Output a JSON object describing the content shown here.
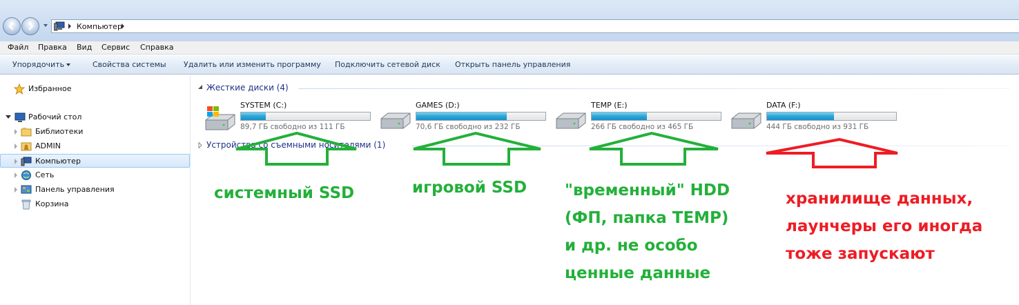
{
  "window": {
    "breadcrumb": "Компьютер"
  },
  "menu": [
    "Файл",
    "Правка",
    "Вид",
    "Сервис",
    "Справка"
  ],
  "toolbar": {
    "organize": "Упорядочить",
    "system_properties": "Свойства системы",
    "uninstall": "Удалить или изменить программу",
    "map_drive": "Подключить сетевой диск",
    "control_panel": "Открыть панель управления"
  },
  "nav": {
    "favorites": "Избранное",
    "desktop": "Рабочий стол",
    "libraries": "Библиотеки",
    "admin": "ADMIN",
    "computer": "Компьютер",
    "network": "Сеть",
    "control_panel": "Панель управления",
    "recycle": "Корзина"
  },
  "groups": {
    "hard_disks": "Жесткие диски (4)",
    "removable": "Устройства со съемными носителями (1)"
  },
  "drives": [
    {
      "name": "SYSTEM (C:)",
      "free": "89,7 ГБ свободно из 111 ГБ",
      "used_fraction": 0.19,
      "icon": "system-drive-icon"
    },
    {
      "name": "GAMES (D:)",
      "free": "70,6 ГБ свободно из 232 ГБ",
      "used_fraction": 0.7,
      "icon": "hard-drive-icon"
    },
    {
      "name": "TEMP (E:)",
      "free": "266 ГБ свободно из 465 ГБ",
      "used_fraction": 0.43,
      "icon": "hard-drive-icon"
    },
    {
      "name": "DATA (F:)",
      "free": "444 ГБ свободно из 931 ГБ",
      "used_fraction": 0.52,
      "icon": "hard-drive-icon"
    }
  ],
  "annotations": {
    "c_label": "системный SSD",
    "d_label": "игровой SSD",
    "e_label": [
      "\"временный\" HDD",
      "(ФП, папка TEMP)",
      "и др. не особо",
      "ценные данные"
    ],
    "f_label": [
      "хранилище данных,",
      "лаунчеры его иногда",
      "тоже запускают"
    ],
    "green_color": "#23b03a",
    "red_color": "#ee1c24"
  }
}
